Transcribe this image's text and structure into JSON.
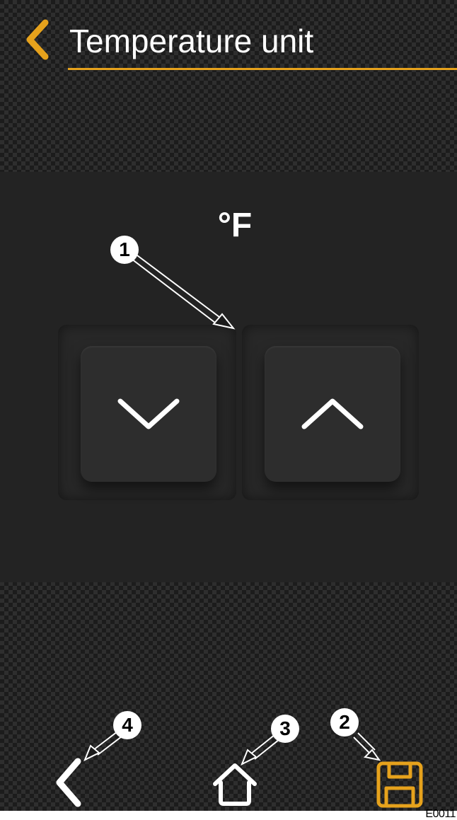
{
  "header": {
    "title": "Temperature unit",
    "back_icon": "chevron-left-icon"
  },
  "setting": {
    "current_value": "°F",
    "decrease_icon": "chevron-down-icon",
    "increase_icon": "chevron-up-icon"
  },
  "callouts": {
    "one": "1",
    "two": "2",
    "three": "3",
    "four": "4"
  },
  "bottom_nav": {
    "back_icon": "chevron-left-icon",
    "home_icon": "home-icon",
    "save_icon": "save-icon"
  },
  "figure": {
    "reference_code": "E0011"
  },
  "colors": {
    "accent": "#e6a21c",
    "background": "#1c1c1c",
    "panel": "#232323",
    "text": "#ffffff"
  }
}
